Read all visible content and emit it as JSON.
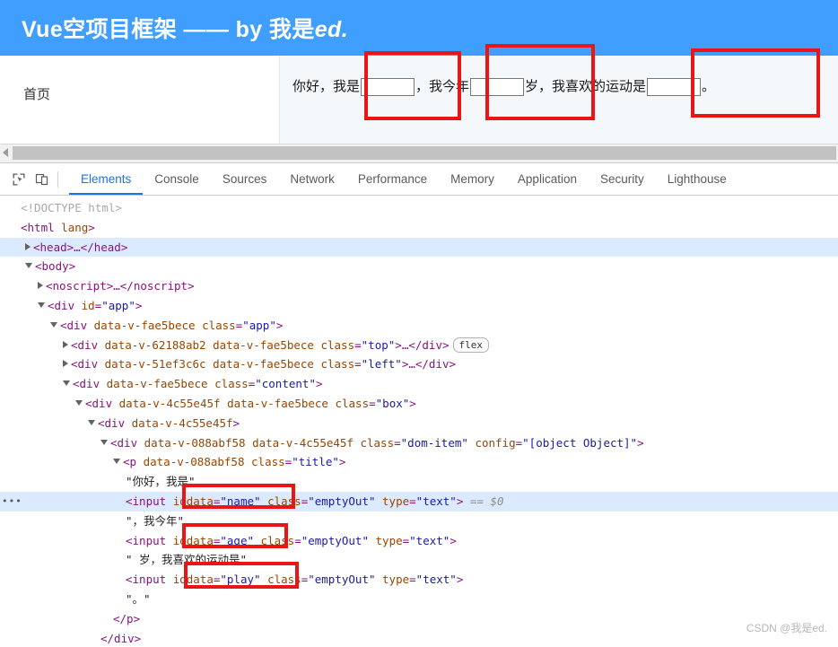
{
  "page": {
    "header_title_main": "Vue空项目框架 —— by 我是",
    "header_title_italic": "ed.",
    "header_bg": "#409eff",
    "sidebar": {
      "items": [
        {
          "label": "首页"
        }
      ]
    },
    "content": {
      "text_1": "你好，我是",
      "text_2": "，我今年",
      "text_3": "岁，我喜欢的运动是",
      "text_4": "。",
      "inputs": [
        {
          "name": "name",
          "value": "",
          "placeholder": ""
        },
        {
          "name": "age",
          "value": "",
          "placeholder": ""
        },
        {
          "name": "play",
          "value": "",
          "placeholder": ""
        }
      ]
    }
  },
  "devtools": {
    "tabs": [
      {
        "label": "Elements",
        "active": true
      },
      {
        "label": "Console",
        "active": false
      },
      {
        "label": "Sources",
        "active": false
      },
      {
        "label": "Network",
        "active": false
      },
      {
        "label": "Performance",
        "active": false
      },
      {
        "label": "Memory",
        "active": false
      },
      {
        "label": "Application",
        "active": false
      },
      {
        "label": "Security",
        "active": false
      },
      {
        "label": "Lighthouse",
        "active": false
      }
    ],
    "tools": [
      {
        "name": "inspect-element-icon"
      },
      {
        "name": "device-toolbar-icon"
      }
    ],
    "accent": "#1a73e8",
    "selection_marker": "== $0",
    "flex_badge": "flex",
    "dom": {
      "l1_doctype": "<!DOCTYPE html>",
      "l2_html_open": "<html",
      "l2_html_attr": "lang",
      "l2_html_close": ">",
      "l3_head": "<head>…</head>",
      "l4_body": "<body>",
      "l5_noscript": "<noscript>…</noscript>",
      "l6_div_app_tag": "<div",
      "l6_div_app_attr": "id",
      "l6_div_app_val": "\"app\"",
      "l7_tag": "<div",
      "l7_a1": "data-v-fae5bece",
      "l7_a2": "class",
      "l7_v2": "\"app\"",
      "l8_tag": "<div",
      "l8_a1": "data-v-62188ab2",
      "l8_a2": "data-v-fae5bece",
      "l8_a3": "class",
      "l8_v3": "\"top\"",
      "l8_tail": ">…</div>",
      "l9_tag": "<div",
      "l9_a1": "data-v-51ef3c6c",
      "l9_a2": "data-v-fae5bece",
      "l9_a3": "class",
      "l9_v3": "\"left\"",
      "l9_tail": ">…</div>",
      "l10_tag": "<div",
      "l10_a1": "data-v-fae5bece",
      "l10_a2": "class",
      "l10_v2": "\"content\"",
      "l11_tag": "<div",
      "l11_a1": "data-v-4c55e45f",
      "l11_a2": "data-v-fae5bece",
      "l11_a3": "class",
      "l11_v3": "\"box\"",
      "l12_tag": "<div",
      "l12_a1": "data-v-4c55e45f",
      "l13_tag": "<div",
      "l13_a1": "data-v-088abf58",
      "l13_a2": "data-v-4c55e45f",
      "l13_a3": "class",
      "l13_v3": "\"dom-item\"",
      "l13_a4": "config",
      "l13_v4": "\"[object Object]\"",
      "l14_tag": "<p",
      "l14_a1": "data-v-088abf58",
      "l14_a2": "class",
      "l14_v2": "\"title\"",
      "l15_text": "\"你好，我是\"",
      "l16_tag": "<input",
      "l16_a1": "iddata",
      "l16_v1": "\"name\"",
      "l16_a2": "class",
      "l16_v2": "\"emptyOut\"",
      "l16_a3": "type",
      "l16_v3": "\"text\"",
      "l17_text": "\"，我今年\"",
      "l18_tag": "<input",
      "l18_a1": "iddata",
      "l18_v1": "\"age\"",
      "l18_a2": "class",
      "l18_v2": "\"emptyOut\"",
      "l18_a3": "type",
      "l18_v3": "\"text\"",
      "l19_text": "\" 岁，我喜欢的运动是\"",
      "l20_tag": "<input",
      "l20_a1": "iddata",
      "l20_v1": "\"play\"",
      "l20_a2": "class",
      "l20_v2": "\"emptyOut\"",
      "l20_a3": "type",
      "l20_v3": "\"text\"",
      "l21_text": "\"。\"",
      "l22_close_p": "</p>",
      "l23_close_div": "</div>"
    }
  },
  "watermark": "CSDN @我是ed.",
  "annotations": {
    "color": "#e81616"
  }
}
